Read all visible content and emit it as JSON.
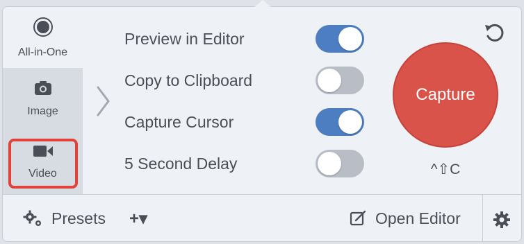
{
  "modes": {
    "all_in_one": "All-in-One",
    "image": "Image",
    "video": "Video"
  },
  "options": [
    {
      "label": "Preview in Editor",
      "enabled": true
    },
    {
      "label": "Copy to Clipboard",
      "enabled": false
    },
    {
      "label": "Capture Cursor",
      "enabled": true
    },
    {
      "label": "5 Second Delay",
      "enabled": false
    }
  ],
  "capture": {
    "label": "Capture",
    "shortcut": "^⇧C"
  },
  "footer": {
    "presets_label": "Presets",
    "add_label": "+▾",
    "open_editor_label": "Open Editor"
  },
  "colors": {
    "accent": "#4d7ec2",
    "capture": "#d9534a",
    "highlight": "#e0433a"
  },
  "icons": {
    "all_in_one": "record-circle-icon",
    "image": "camera-icon",
    "video": "video-camera-icon",
    "reset": "reset-icon",
    "presets": "gear-icon",
    "open_editor": "edit-icon",
    "settings": "gear-icon"
  }
}
